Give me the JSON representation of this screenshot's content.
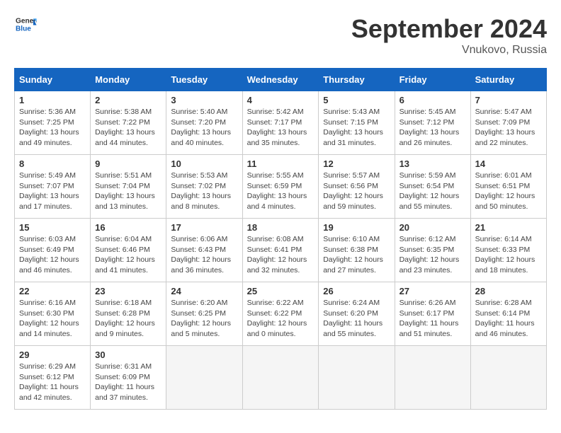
{
  "logo": {
    "line1": "General",
    "line2": "Blue"
  },
  "title": "September 2024",
  "location": "Vnukovo, Russia",
  "weekdays": [
    "Sunday",
    "Monday",
    "Tuesday",
    "Wednesday",
    "Thursday",
    "Friday",
    "Saturday"
  ],
  "weeks": [
    [
      {
        "day": "1",
        "info": "Sunrise: 5:36 AM\nSunset: 7:25 PM\nDaylight: 13 hours and 49 minutes."
      },
      {
        "day": "2",
        "info": "Sunrise: 5:38 AM\nSunset: 7:22 PM\nDaylight: 13 hours and 44 minutes."
      },
      {
        "day": "3",
        "info": "Sunrise: 5:40 AM\nSunset: 7:20 PM\nDaylight: 13 hours and 40 minutes."
      },
      {
        "day": "4",
        "info": "Sunrise: 5:42 AM\nSunset: 7:17 PM\nDaylight: 13 hours and 35 minutes."
      },
      {
        "day": "5",
        "info": "Sunrise: 5:43 AM\nSunset: 7:15 PM\nDaylight: 13 hours and 31 minutes."
      },
      {
        "day": "6",
        "info": "Sunrise: 5:45 AM\nSunset: 7:12 PM\nDaylight: 13 hours and 26 minutes."
      },
      {
        "day": "7",
        "info": "Sunrise: 5:47 AM\nSunset: 7:09 PM\nDaylight: 13 hours and 22 minutes."
      }
    ],
    [
      {
        "day": "8",
        "info": "Sunrise: 5:49 AM\nSunset: 7:07 PM\nDaylight: 13 hours and 17 minutes."
      },
      {
        "day": "9",
        "info": "Sunrise: 5:51 AM\nSunset: 7:04 PM\nDaylight: 13 hours and 13 minutes."
      },
      {
        "day": "10",
        "info": "Sunrise: 5:53 AM\nSunset: 7:02 PM\nDaylight: 13 hours and 8 minutes."
      },
      {
        "day": "11",
        "info": "Sunrise: 5:55 AM\nSunset: 6:59 PM\nDaylight: 13 hours and 4 minutes."
      },
      {
        "day": "12",
        "info": "Sunrise: 5:57 AM\nSunset: 6:56 PM\nDaylight: 12 hours and 59 minutes."
      },
      {
        "day": "13",
        "info": "Sunrise: 5:59 AM\nSunset: 6:54 PM\nDaylight: 12 hours and 55 minutes."
      },
      {
        "day": "14",
        "info": "Sunrise: 6:01 AM\nSunset: 6:51 PM\nDaylight: 12 hours and 50 minutes."
      }
    ],
    [
      {
        "day": "15",
        "info": "Sunrise: 6:03 AM\nSunset: 6:49 PM\nDaylight: 12 hours and 46 minutes."
      },
      {
        "day": "16",
        "info": "Sunrise: 6:04 AM\nSunset: 6:46 PM\nDaylight: 12 hours and 41 minutes."
      },
      {
        "day": "17",
        "info": "Sunrise: 6:06 AM\nSunset: 6:43 PM\nDaylight: 12 hours and 36 minutes."
      },
      {
        "day": "18",
        "info": "Sunrise: 6:08 AM\nSunset: 6:41 PM\nDaylight: 12 hours and 32 minutes."
      },
      {
        "day": "19",
        "info": "Sunrise: 6:10 AM\nSunset: 6:38 PM\nDaylight: 12 hours and 27 minutes."
      },
      {
        "day": "20",
        "info": "Sunrise: 6:12 AM\nSunset: 6:35 PM\nDaylight: 12 hours and 23 minutes."
      },
      {
        "day": "21",
        "info": "Sunrise: 6:14 AM\nSunset: 6:33 PM\nDaylight: 12 hours and 18 minutes."
      }
    ],
    [
      {
        "day": "22",
        "info": "Sunrise: 6:16 AM\nSunset: 6:30 PM\nDaylight: 12 hours and 14 minutes."
      },
      {
        "day": "23",
        "info": "Sunrise: 6:18 AM\nSunset: 6:28 PM\nDaylight: 12 hours and 9 minutes."
      },
      {
        "day": "24",
        "info": "Sunrise: 6:20 AM\nSunset: 6:25 PM\nDaylight: 12 hours and 5 minutes."
      },
      {
        "day": "25",
        "info": "Sunrise: 6:22 AM\nSunset: 6:22 PM\nDaylight: 12 hours and 0 minutes."
      },
      {
        "day": "26",
        "info": "Sunrise: 6:24 AM\nSunset: 6:20 PM\nDaylight: 11 hours and 55 minutes."
      },
      {
        "day": "27",
        "info": "Sunrise: 6:26 AM\nSunset: 6:17 PM\nDaylight: 11 hours and 51 minutes."
      },
      {
        "day": "28",
        "info": "Sunrise: 6:28 AM\nSunset: 6:14 PM\nDaylight: 11 hours and 46 minutes."
      }
    ],
    [
      {
        "day": "29",
        "info": "Sunrise: 6:29 AM\nSunset: 6:12 PM\nDaylight: 11 hours and 42 minutes."
      },
      {
        "day": "30",
        "info": "Sunrise: 6:31 AM\nSunset: 6:09 PM\nDaylight: 11 hours and 37 minutes."
      },
      null,
      null,
      null,
      null,
      null
    ]
  ]
}
